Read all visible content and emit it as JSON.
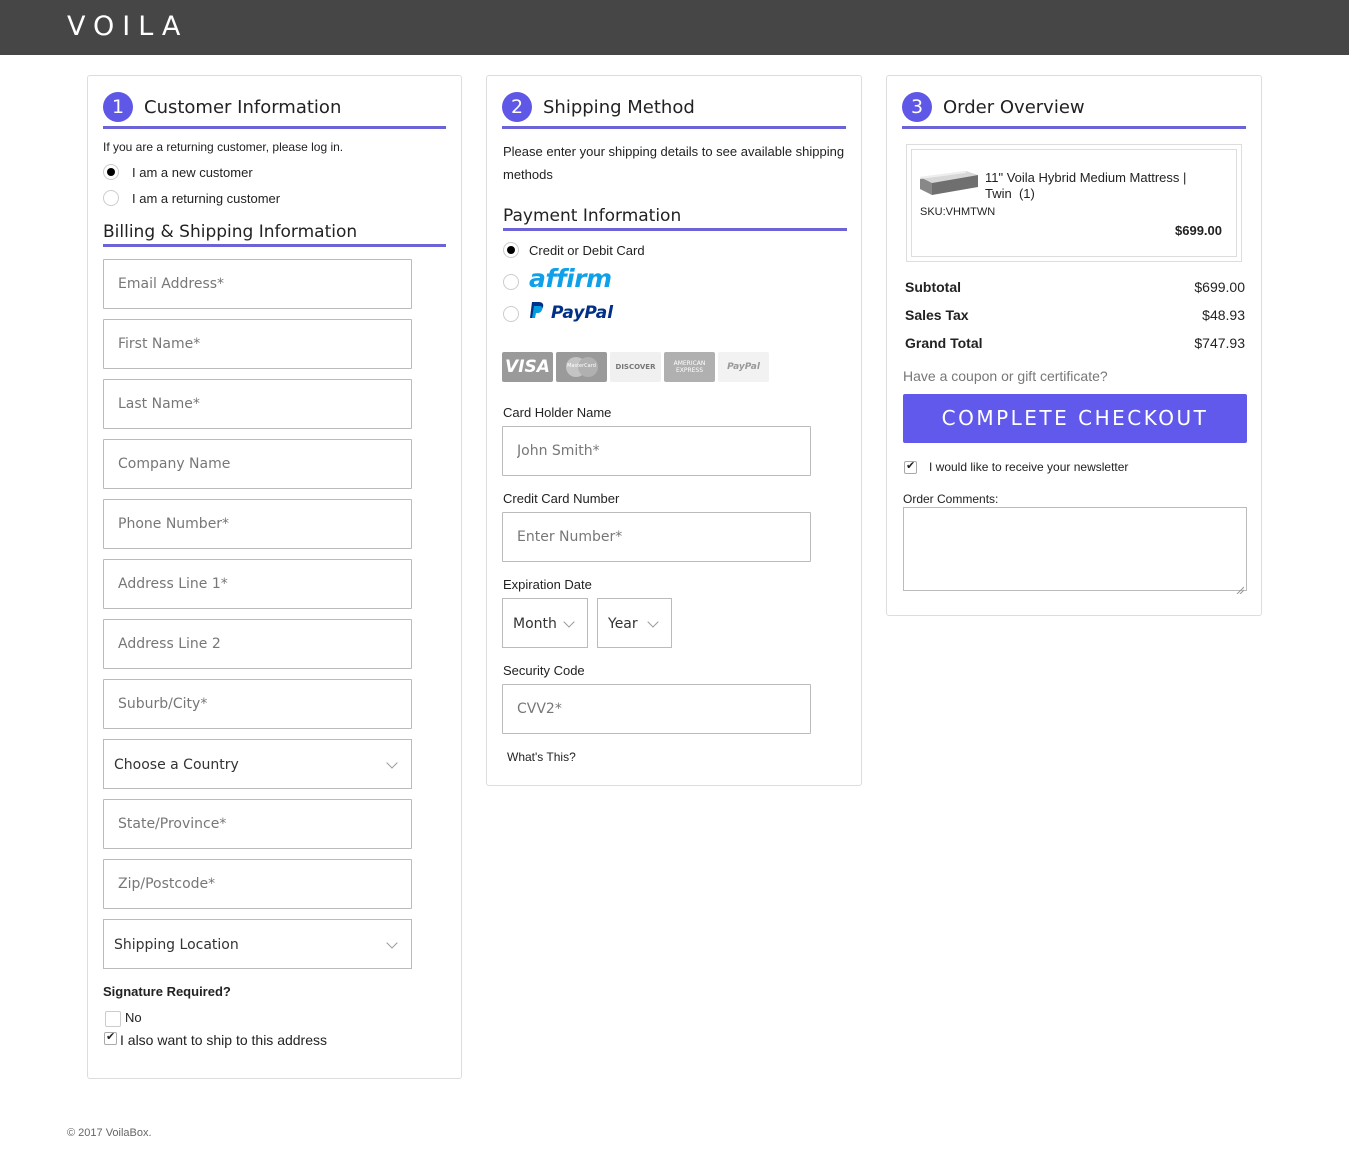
{
  "header": {
    "logo": "VOILA"
  },
  "customer": {
    "step": "1",
    "title": "Customer Information",
    "returning_note": "If you are a returning customer, please log in.",
    "radio_new": "I am a new customer",
    "radio_returning": "I am a returning customer",
    "billing_title": "Billing & Shipping Information",
    "email_ph": "Email Address*",
    "first_ph": "First Name*",
    "last_ph": "Last Name*",
    "company_ph": "Company Name",
    "phone_ph": "Phone Number*",
    "addr1_ph": "Address Line 1*",
    "addr2_ph": "Address Line 2",
    "city_ph": "Suburb/City*",
    "country_select": "Choose a Country",
    "state_ph": "State/Province*",
    "zip_ph": "Zip/Postcode*",
    "shipping_location_select": "Shipping Location",
    "signature_title": "Signature Required?",
    "signature_no": "No",
    "ship_same": "I also want to ship to this address"
  },
  "shipping": {
    "step": "2",
    "title": "Shipping Method",
    "note": "Please enter your shipping details to see available shipping methods",
    "payment_title": "Payment Information",
    "opt_card": "Credit or Debit Card",
    "opt_affirm": "affirm",
    "opt_paypal": "PayPal",
    "card_badges": {
      "visa": "VISA",
      "mastercard": "MasterCard",
      "discover": "DISCOVER",
      "amex": "AMERICAN EXPRESS",
      "paypal": "PayPal"
    },
    "holder_label": "Card Holder Name",
    "holder_ph": "John Smith*",
    "number_label": "Credit Card Number",
    "number_ph": "Enter Number*",
    "exp_label": "Expiration Date",
    "month": "Month",
    "year": "Year",
    "security_label": "Security Code",
    "cvv_ph": "CVV2*",
    "whats_this": "What's This?"
  },
  "order": {
    "step": "3",
    "title": "Order Overview",
    "product_name": "11\" Voila Hybrid Medium Mattress | Twin",
    "product_qty": "(1)",
    "sku": "SKU:VHMTWN",
    "product_price": "$699.00",
    "subtotal_label": "Subtotal",
    "subtotal": "$699.00",
    "tax_label": "Sales Tax",
    "tax": "$48.93",
    "total_label": "Grand Total",
    "total": "$747.93",
    "coupon": "Have a coupon or gift certificate?",
    "checkout": "COMPLETE CHECKOUT",
    "newsletter": "I would like to receive your newsletter",
    "comments_label": "Order Comments:"
  },
  "footer": {
    "copyright": "© 2017 VoilaBox."
  },
  "colors": {
    "accent": "#6159ec",
    "header": "#464646",
    "affirm": "#0fa0ea",
    "paypal_dark": "#003087",
    "paypal_light": "#009cde"
  }
}
